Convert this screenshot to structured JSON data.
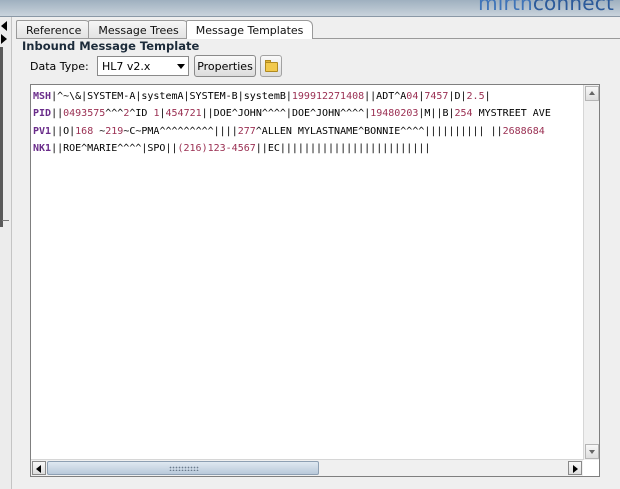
{
  "header": {
    "logo_left": "mirth",
    "logo_right": "connect"
  },
  "tabs": [
    {
      "label": "Reference"
    },
    {
      "label": "Message Trees"
    },
    {
      "label": "Message Templates"
    }
  ],
  "panel": {
    "title": "Inbound Message Template",
    "data_type_label": "Data Type:",
    "data_type_value": "HL7 v2.x",
    "properties_label": "Properties",
    "open_icon": "folder-open-icon"
  },
  "editor": {
    "lines": [
      {
        "segment": "MSH",
        "text": "|^~\\&|SYSTEM-A|systemA|SYSTEM-B|systemB|199912271408||ADT^A04|7457|D|2.5|"
      },
      {
        "segment": "PID",
        "text": "||0493575^^^2^ID 1|454721||DOE^JOHN^^^^|DOE^JOHN^^^^|19480203|M||B|254 MYSTREET AVE"
      },
      {
        "segment": "PV1",
        "text": "||O|168 ~219~C~PMA^^^^^^^^^||||277^ALLEN MYLASTNAME^BONNIE^^^^|||||||||| ||2688684"
      },
      {
        "segment": "NK1",
        "text": "||ROE^MARIE^^^^|SPO||(216)123-4567||EC|||||||||||||||||||||||||"
      }
    ]
  },
  "colors": {
    "segment": "#6a2c8a",
    "number": "#9a2f52",
    "thumb": "#b9c9da"
  }
}
